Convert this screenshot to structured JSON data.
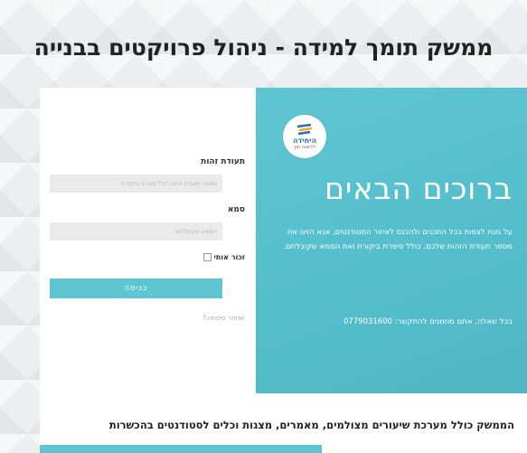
{
  "page": {
    "title": "ממשק תומך למידה - ניהול פרויקטים בבנייה"
  },
  "welcome": {
    "heading": "ברוכים הבאים",
    "logo_line1": "היחידה",
    "logo_line2": "ללימודי חוץ",
    "paragraph": "על מנת לצפות בכל התכנים ולהכנס לאיזור הסטודנטים, אנא הזינו את מספר תעודת הזהות שלכם, כולל סיפרת ביקורת ואת הסמא שקיבלתם.",
    "contact": "בכל שאלה, אתם מוזמנים להתקשר: 0779031600"
  },
  "login": {
    "id_label": "תעודת זהות",
    "id_placeholder": "מספר תעודת זהות כולל ספרת ביקורת",
    "password_label": "סמא",
    "password_placeholder": "הסמא שקיבלתם",
    "remember_label": "זכור אותי",
    "submit_label": "כניסה",
    "forgot_label": "שחזור סיסמה?"
  },
  "footer": {
    "text": "הממשק כולל מערכת שיעורים מצולמים, מאמרים, מצגות וכלים לסטודנטים בהכשרות"
  },
  "colors": {
    "accent": "#5ec6d3",
    "background": "#eceeef"
  }
}
